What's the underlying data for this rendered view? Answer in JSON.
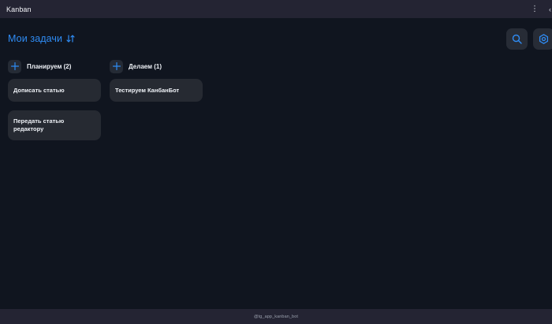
{
  "app": {
    "title": "Kanban",
    "menu_glyph": "⋮",
    "edge_glyph": "‹",
    "menu_icon": "kebab-menu-icon"
  },
  "header": {
    "title": "Мои задачи",
    "sort_icon": "sort-arrows-icon",
    "search_icon": "search-icon",
    "settings_icon": "settings-icon"
  },
  "columns": [
    {
      "title": "Планируем (2)",
      "add_icon": "plus-icon",
      "cards": [
        {
          "text": "Дописать статью"
        },
        {
          "text": "Передать статью редактору"
        }
      ]
    },
    {
      "title": "Делаем (1)",
      "add_icon": "plus-icon",
      "cards": [
        {
          "text": "Тестируем КанбанБот"
        }
      ]
    }
  ],
  "footer": {
    "text": "@tg_app_kanban_bot"
  },
  "colors": {
    "background": "#10151f",
    "bar": "#242433",
    "accent": "#2f8cf4",
    "card": "#262a32",
    "button": "#272c36"
  }
}
